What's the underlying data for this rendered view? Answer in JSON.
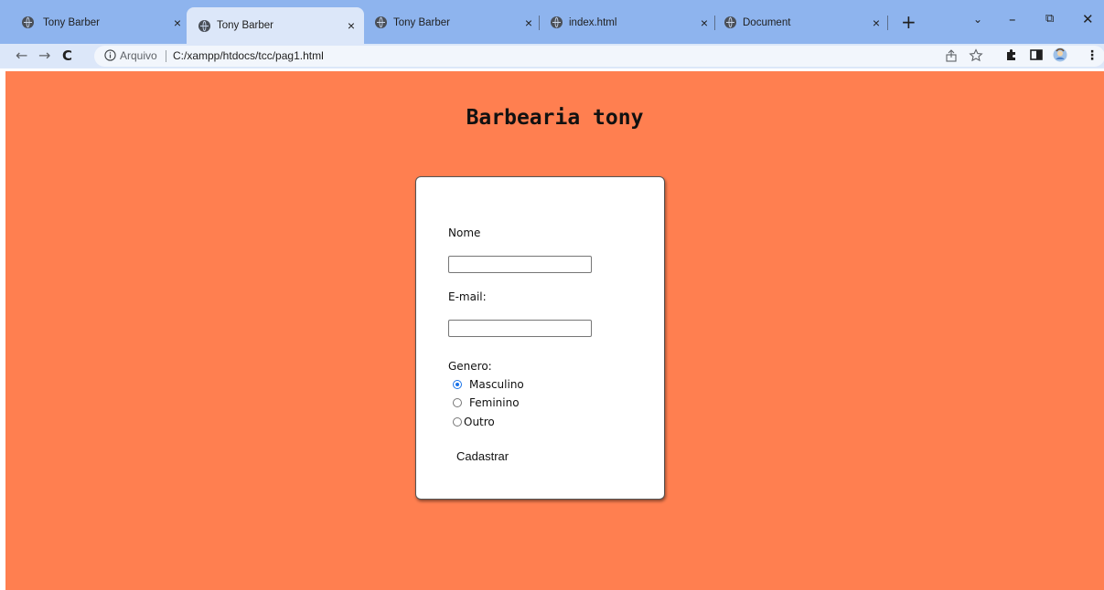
{
  "browser": {
    "tabs": [
      {
        "title": "Tony Barber",
        "active": false
      },
      {
        "title": "Tony Barber",
        "active": true
      },
      {
        "title": "Tony Barber",
        "active": false
      },
      {
        "title": "index.html",
        "active": false
      },
      {
        "title": "Document",
        "active": false
      }
    ],
    "address_prefix": "Arquivo",
    "url": "C:/xampp/htdocs/tcc/pag1.html"
  },
  "page": {
    "title": "Barbearia tony",
    "background_color": "#ff7f50",
    "form": {
      "name_label": "Nome",
      "name_value": "",
      "email_label": "E-mail:",
      "email_value": "",
      "gender_label": "Genero:",
      "gender_options": [
        {
          "label": "Masculino",
          "checked": true
        },
        {
          "label": "Feminino",
          "checked": false
        },
        {
          "label": "Outro",
          "checked": false
        }
      ],
      "submit_label": "Cadastrar"
    }
  }
}
